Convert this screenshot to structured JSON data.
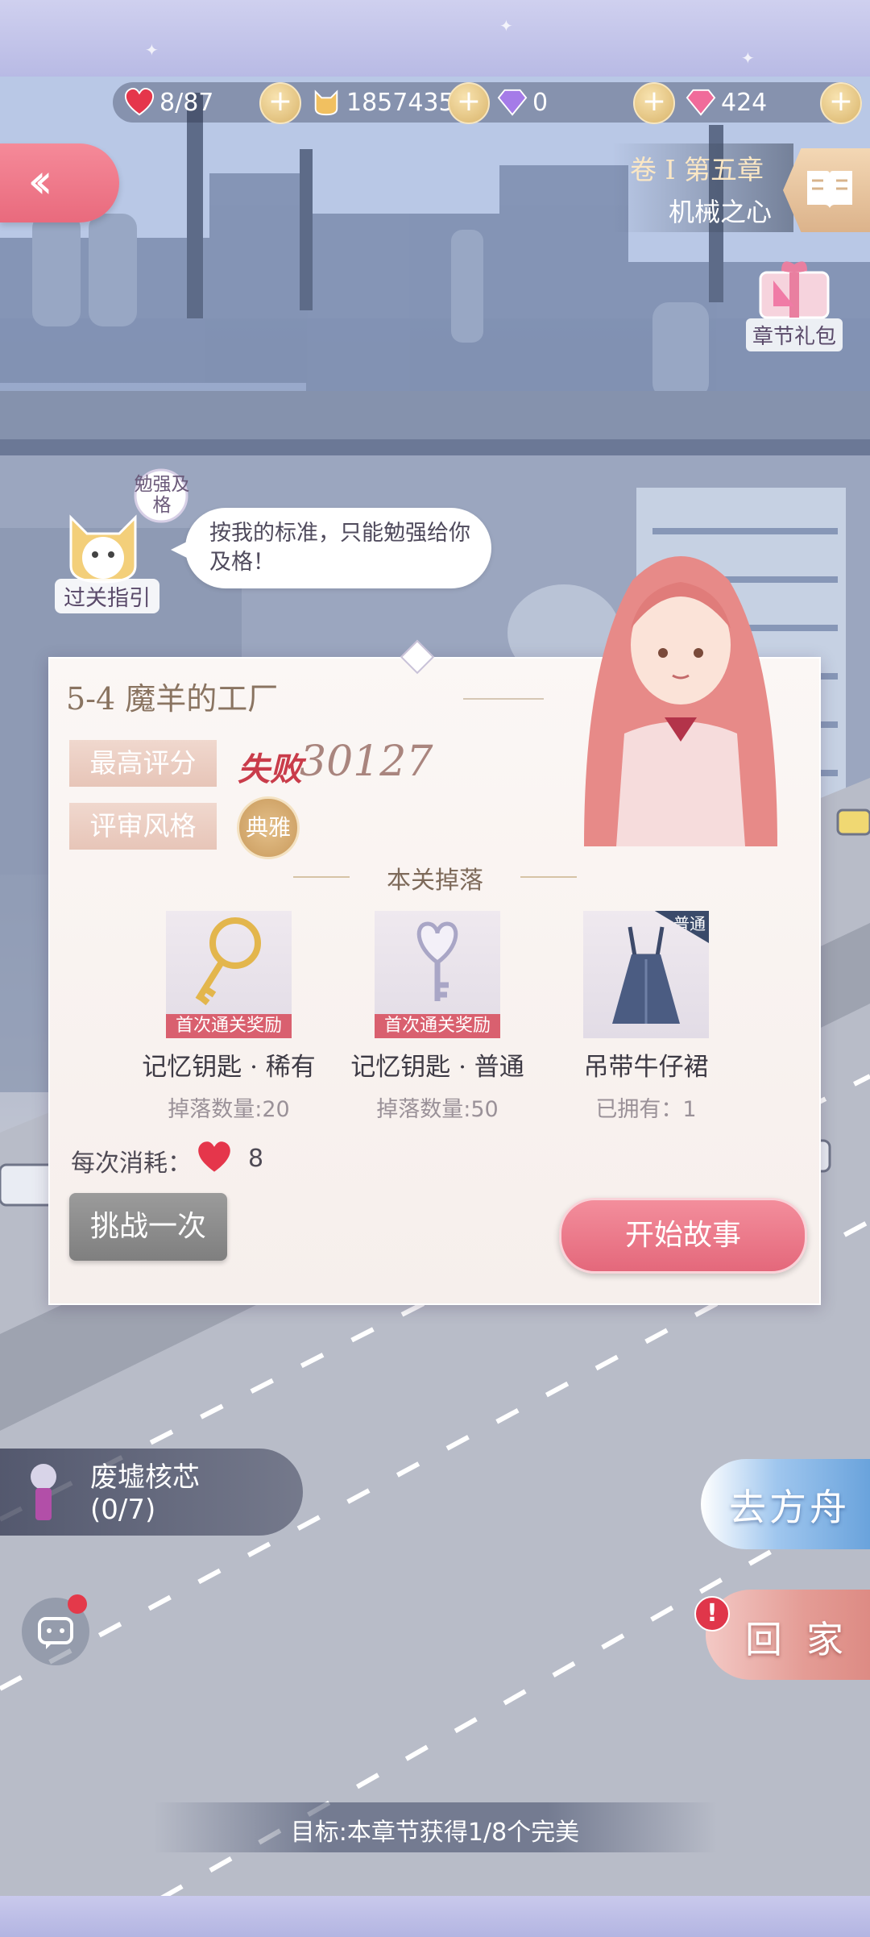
{
  "resources": {
    "stamina": "8/87",
    "gold": "1857435",
    "diamond": "0",
    "crystal": "424"
  },
  "chapter": {
    "volume": "卷 I 第五章",
    "name": "机械之心"
  },
  "gift_label": "章节礼包",
  "guide": {
    "badge": "勉强及格",
    "label": "过关指引",
    "speech": "按我的标准，只能勉强给你及格！"
  },
  "stage": {
    "title": "5-4 魔羊的工厂",
    "best_label": "最高评分",
    "best_result": "失败",
    "best_score": "30127",
    "judge_label": "评审风格",
    "judge_style": "典雅",
    "drops_title": "本关掉落",
    "drops": [
      {
        "name": "记忆钥匙 · 稀有",
        "tag": "首次通关奖励",
        "qty": "掉落数量:20"
      },
      {
        "name": "记忆钥匙 · 普通",
        "tag": "首次通关奖励",
        "qty": "掉落数量:50"
      },
      {
        "name": "吊带牛仔裙",
        "ribbon": "普通",
        "qty": "已拥有：1"
      }
    ],
    "cost_label": "每次消耗：",
    "cost_value": "8",
    "challenge_label": "挑战一次",
    "start_label": "开始故事"
  },
  "ruins": {
    "title": "废墟核芯",
    "count": "(0/7)"
  },
  "ark_label": "去方舟",
  "home_label": "回家",
  "home_alert": "!",
  "objective": "目标:本章节获得1/8个完美",
  "colors": {
    "accent_pink": "#e96a7d",
    "gold": "#d9b46a",
    "fail_red": "#c93c4a"
  }
}
